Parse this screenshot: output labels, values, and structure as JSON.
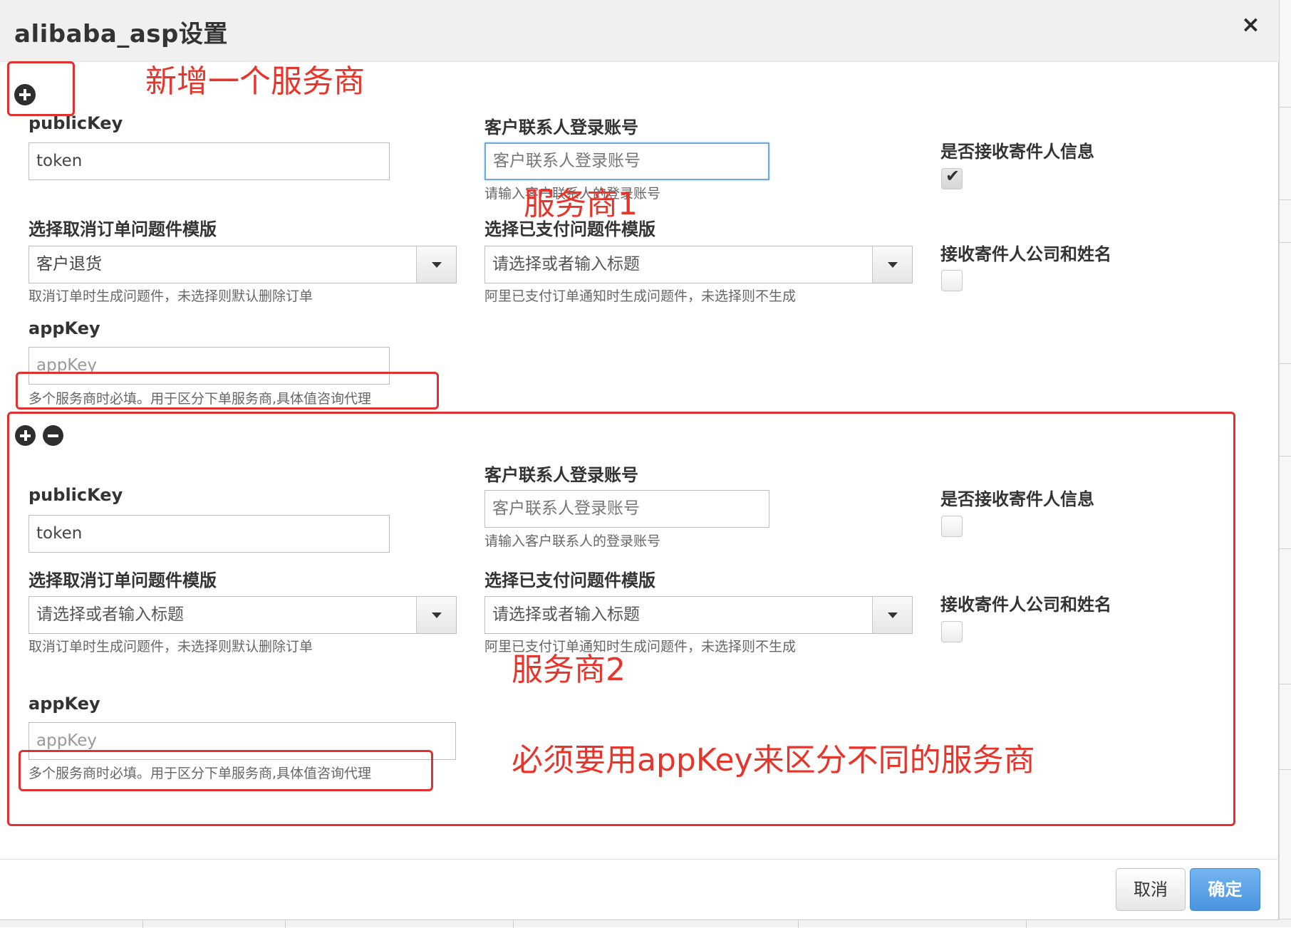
{
  "dialog": {
    "title": "alibaba_asp设置",
    "close_icon": "×",
    "cancel_label": "取消",
    "ok_label": "确定"
  },
  "providers": [
    {
      "public_key_label": "publicKey",
      "public_key_value": "token",
      "contact_label": "客户联系人登录账号",
      "contact_placeholder": "客户联系人登录账号",
      "contact_help": "请输入客户联系人的登录账号",
      "receive_sender_label": "是否接收寄件人信息",
      "receive_sender_checked": true,
      "cancel_template_label": "选择取消订单问题件模版",
      "cancel_template_value": "客户退货",
      "cancel_template_help": "取消订单时生成问题件，未选择则默认删除订单",
      "paid_template_label": "选择已支付问题件模版",
      "paid_template_value": "请选择或者输入标题",
      "paid_template_help": "阿里已支付订单通知时生成问题件，未选择则不生成",
      "receive_company_label": "接收寄件人公司和姓名",
      "receive_company_checked": false,
      "app_key_label": "appKey",
      "app_key_placeholder": "appKey",
      "app_key_help": "多个服务商时必填。用于区分下单服务商,具体值咨询代理"
    },
    {
      "public_key_label": "publicKey",
      "public_key_value": "token",
      "contact_label": "客户联系人登录账号",
      "contact_placeholder": "客户联系人登录账号",
      "contact_help": "请输入客户联系人的登录账号",
      "receive_sender_label": "是否接收寄件人信息",
      "receive_sender_checked": false,
      "cancel_template_label": "选择取消订单问题件模版",
      "cancel_template_value": "请选择或者输入标题",
      "cancel_template_help": "取消订单时生成问题件，未选择则默认删除订单",
      "paid_template_label": "选择已支付问题件模版",
      "paid_template_value": "请选择或者输入标题",
      "paid_template_help": "阿里已支付订单通知时生成问题件，未选择则不生成",
      "receive_company_label": "接收寄件人公司和姓名",
      "receive_company_checked": false,
      "app_key_label": "appKey",
      "app_key_placeholder": "appKey",
      "app_key_help": "多个服务商时必填。用于区分下单服务商,具体值咨询代理"
    }
  ],
  "annotations": {
    "add_provider": "新增一个服务商",
    "provider1": "服务商1",
    "provider2": "服务商2",
    "appkey_note": "必须要用appKey来区分不同的服务商",
    "color": "#e8352b"
  },
  "icons": {
    "add": "plus-circle-icon",
    "remove": "minus-circle-icon",
    "close": "close-icon",
    "dropdown": "caret-down-icon",
    "check": "check-icon"
  }
}
